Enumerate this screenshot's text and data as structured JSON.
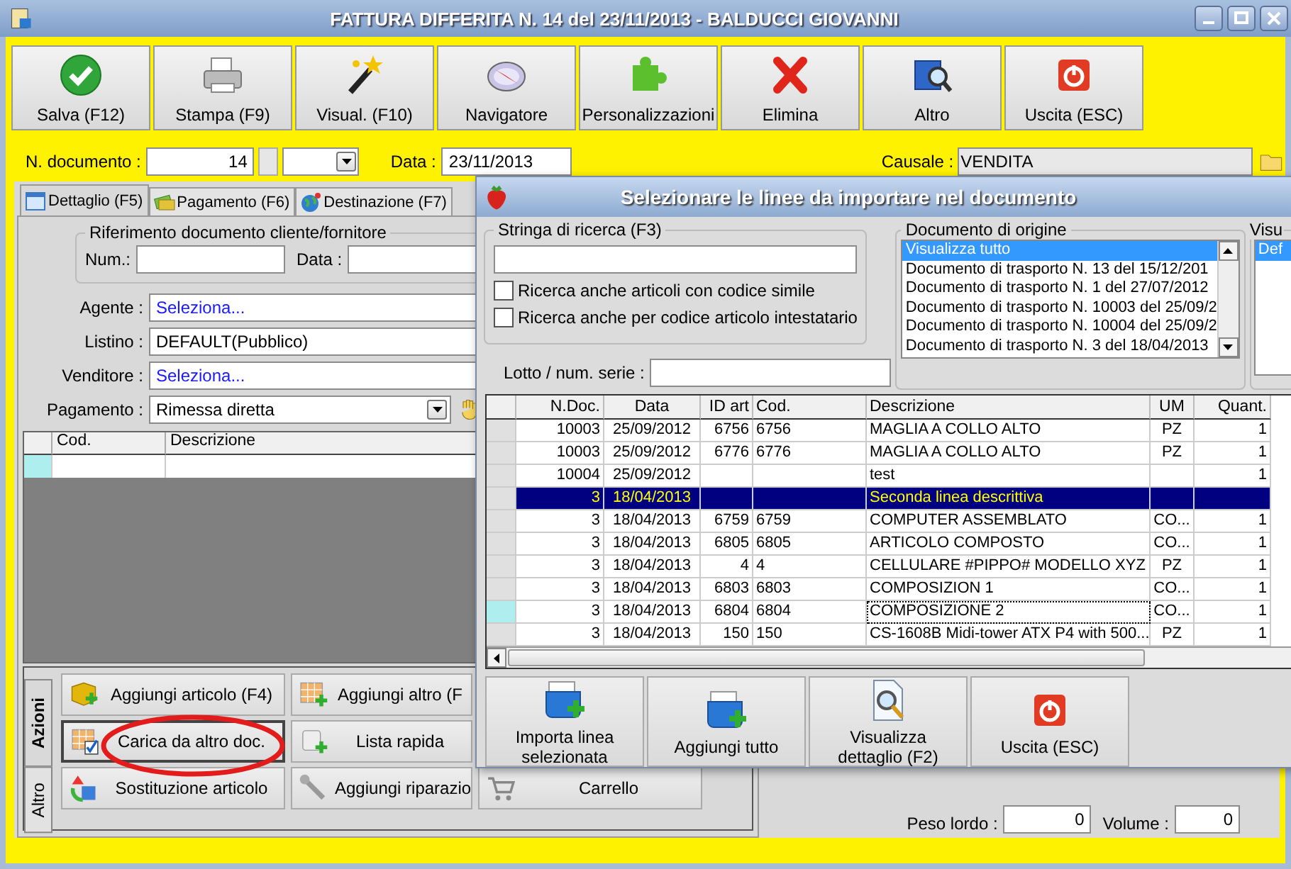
{
  "window": {
    "title": "FATTURA DIFFERITA N. 14 del 23/11/2013 - BALDUCCI GIOVANNI"
  },
  "toolbar": [
    "Salva (F12)",
    "Stampa (F9)",
    "Visual. (F10)",
    "Navigatore",
    "Personalizzazioni",
    "Elimina",
    "Altro",
    "Uscita (ESC)"
  ],
  "document": {
    "number_label": "N. documento :",
    "number": "14",
    "date_label": "Data :",
    "date": "23/11/2013",
    "causale_label": "Causale :",
    "causale": "VENDITA"
  },
  "tabs": [
    {
      "label": "Dettaglio (F5)",
      "selected": true
    },
    {
      "label": "Pagamento (F6)",
      "selected": false
    },
    {
      "label": "Destinazione (F7)",
      "selected": false
    }
  ],
  "reference": {
    "legend": "Riferimento documento cliente/fornitore",
    "num_label": "Num.:",
    "date_label": "Data :"
  },
  "fields": [
    {
      "label": "Agente :",
      "value": "Seleziona...",
      "kind": "link"
    },
    {
      "label": "Listino :",
      "value": "DEFAULT(Pubblico)",
      "kind": "text"
    },
    {
      "label": "Venditore :",
      "value": "Seleziona...",
      "kind": "link"
    },
    {
      "label": "Pagamento :",
      "value": "Rimessa diretta",
      "kind": "combo"
    }
  ],
  "lines_grid": {
    "columns": [
      "Cod.",
      "Descrizione"
    ]
  },
  "action_tabs": [
    {
      "label": "Azioni",
      "selected": true
    },
    {
      "label": "Altro",
      "selected": false
    }
  ],
  "actions": [
    [
      "Aggiungi articolo (F4)",
      "Aggiungi altro (F"
    ],
    [
      "Carica da altro doc.",
      "Lista rapida"
    ],
    [
      "Sostituzione articolo",
      "Aggiungi riparazio",
      "Carrello"
    ]
  ],
  "totals": [
    {
      "label": "Peso lordo :",
      "value": "0"
    },
    {
      "label": "Volume :",
      "value": "0"
    }
  ],
  "dialog": {
    "title": "Selezionare le linee da importare nel documento",
    "search": {
      "legend": "Stringa di ricerca (F3)",
      "options": [
        {
          "label": "Ricerca anche articoli con codice simile",
          "checked": false
        },
        {
          "label": "Ricerca anche per codice articolo intestatario",
          "checked": false
        }
      ]
    },
    "lot_label": "Lotto / num. serie :",
    "origin": {
      "legend": "Documento di origine",
      "items": [
        {
          "label": "Visualizza tutto",
          "selected": true
        },
        {
          "label": "Documento di trasporto N. 13 del 15/12/201",
          "selected": false
        },
        {
          "label": "Documento di trasporto N. 1 del 27/07/2012",
          "selected": false
        },
        {
          "label": "Documento di trasporto N. 10003 del 25/09/2",
          "selected": false
        },
        {
          "label": "Documento di trasporto N. 10004 del 25/09/2",
          "selected": false
        },
        {
          "label": "Documento di trasporto N. 3 del 18/04/2013",
          "selected": false
        }
      ]
    },
    "view": {
      "legend": "Visu",
      "items": [
        {
          "label": "Def",
          "selected": true
        }
      ]
    },
    "table": {
      "columns": [
        "N.Doc.",
        "Data",
        "ID art",
        "Cod.",
        "Descrizione",
        "UM",
        "Quant."
      ],
      "rows": [
        {
          "cells": [
            "10003",
            "25/09/2012",
            "6756",
            "6756",
            "MAGLIA A COLLO ALTO",
            "PZ",
            "1"
          ],
          "selected": false,
          "current": false
        },
        {
          "cells": [
            "10003",
            "25/09/2012",
            "6776",
            "6776",
            "MAGLIA A COLLO ALTO",
            "PZ",
            "1"
          ],
          "selected": false,
          "current": false
        },
        {
          "cells": [
            "10004",
            "25/09/2012",
            "",
            "",
            "test",
            "",
            "1"
          ],
          "selected": false,
          "current": false
        },
        {
          "cells": [
            "3",
            "18/04/2013",
            "",
            "",
            "Seconda linea descrittiva",
            "",
            ""
          ],
          "selected": true,
          "current": false
        },
        {
          "cells": [
            "3",
            "18/04/2013",
            "6759",
            "6759",
            "COMPUTER ASSEMBLATO",
            "CO...",
            "1"
          ],
          "selected": false,
          "current": false
        },
        {
          "cells": [
            "3",
            "18/04/2013",
            "6805",
            "6805",
            "ARTICOLO COMPOSTO",
            "CO...",
            "1"
          ],
          "selected": false,
          "current": false
        },
        {
          "cells": [
            "3",
            "18/04/2013",
            "4",
            "4",
            "CELLULARE #PIPPO# MODELLO XYZ",
            "PZ",
            "1"
          ],
          "selected": false,
          "current": false
        },
        {
          "cells": [
            "3",
            "18/04/2013",
            "6803",
            "6803",
            "COMPOSIZION 1",
            "CO...",
            "1"
          ],
          "selected": false,
          "current": false
        },
        {
          "cells": [
            "3",
            "18/04/2013",
            "6804",
            "6804",
            "COMPOSIZIONE 2",
            "CO...",
            "1"
          ],
          "selected": false,
          "current": true
        },
        {
          "cells": [
            "3",
            "18/04/2013",
            "150",
            "150",
            "CS-1608B Midi-tower ATX P4 with 500...",
            "PZ",
            "1"
          ],
          "selected": false,
          "current": false
        }
      ]
    },
    "buttons": [
      "Importa linea selezionata",
      "Aggiungi tutto",
      "Visualizza dettaglio (F2)",
      "Uscita (ESC)"
    ]
  }
}
